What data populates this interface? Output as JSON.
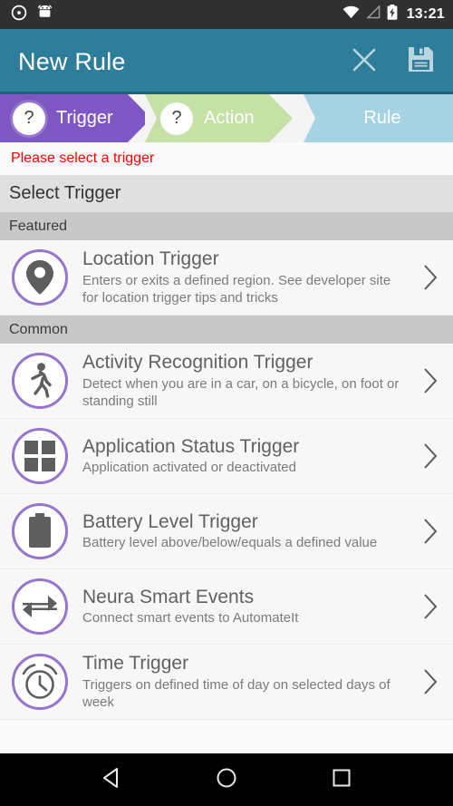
{
  "status_bar": {
    "icons": [
      "alarm-dot-icon",
      "android-robot-icon"
    ],
    "right_icons": [
      "wifi-icon",
      "cellular-signal-icon",
      "battery-charging-icon"
    ],
    "clock": "13:21"
  },
  "toolbar": {
    "title": "New Rule",
    "close_icon": "close-icon",
    "save_icon": "save-floppy-icon",
    "background": "#2e7d9a"
  },
  "steps": [
    {
      "label": "Trigger",
      "badge": "?",
      "state": "active",
      "color": "#7e57c2"
    },
    {
      "label": "Action",
      "badge": "?",
      "state": "pending",
      "color": "#c5e1a5"
    },
    {
      "label": "Rule",
      "badge": "",
      "state": "pending",
      "color": "#a5d3e3"
    }
  ],
  "error": {
    "message": "Please select a trigger",
    "color": "#ff0000"
  },
  "list": {
    "header": "Select Trigger",
    "sections": [
      {
        "title": "Featured",
        "items": [
          {
            "title": "Location Trigger",
            "description": "Enters or exits a defined region. See developer site for location trigger tips and tricks",
            "icon": "map-pin-icon"
          }
        ]
      },
      {
        "title": "Common",
        "items": [
          {
            "title": "Activity Recognition Trigger",
            "description": "Detect when you are in a car, on a bicycle, on foot or standing still",
            "icon": "walking-person-icon"
          },
          {
            "title": "Application Status Trigger",
            "description": "Application activated or deactivated",
            "icon": "apps-grid-icon"
          },
          {
            "title": "Battery Level Trigger",
            "description": "Battery level above/below/equals a defined value",
            "icon": "battery-icon"
          },
          {
            "title": "Neura Smart Events",
            "description": "Connect smart events to AutomateIt",
            "icon": "two-way-arrows-icon"
          },
          {
            "title": "Time Trigger",
            "description": "Triggers on defined time of day on selected days of week",
            "icon": "alarm-clock-icon"
          }
        ]
      }
    ],
    "chevron_icon": "chevron-right-icon",
    "icon_ring_color": "#9575cd"
  },
  "nav_bar": {
    "back": "back-triangle-icon",
    "home": "home-circle-icon",
    "recents": "recents-square-icon"
  }
}
